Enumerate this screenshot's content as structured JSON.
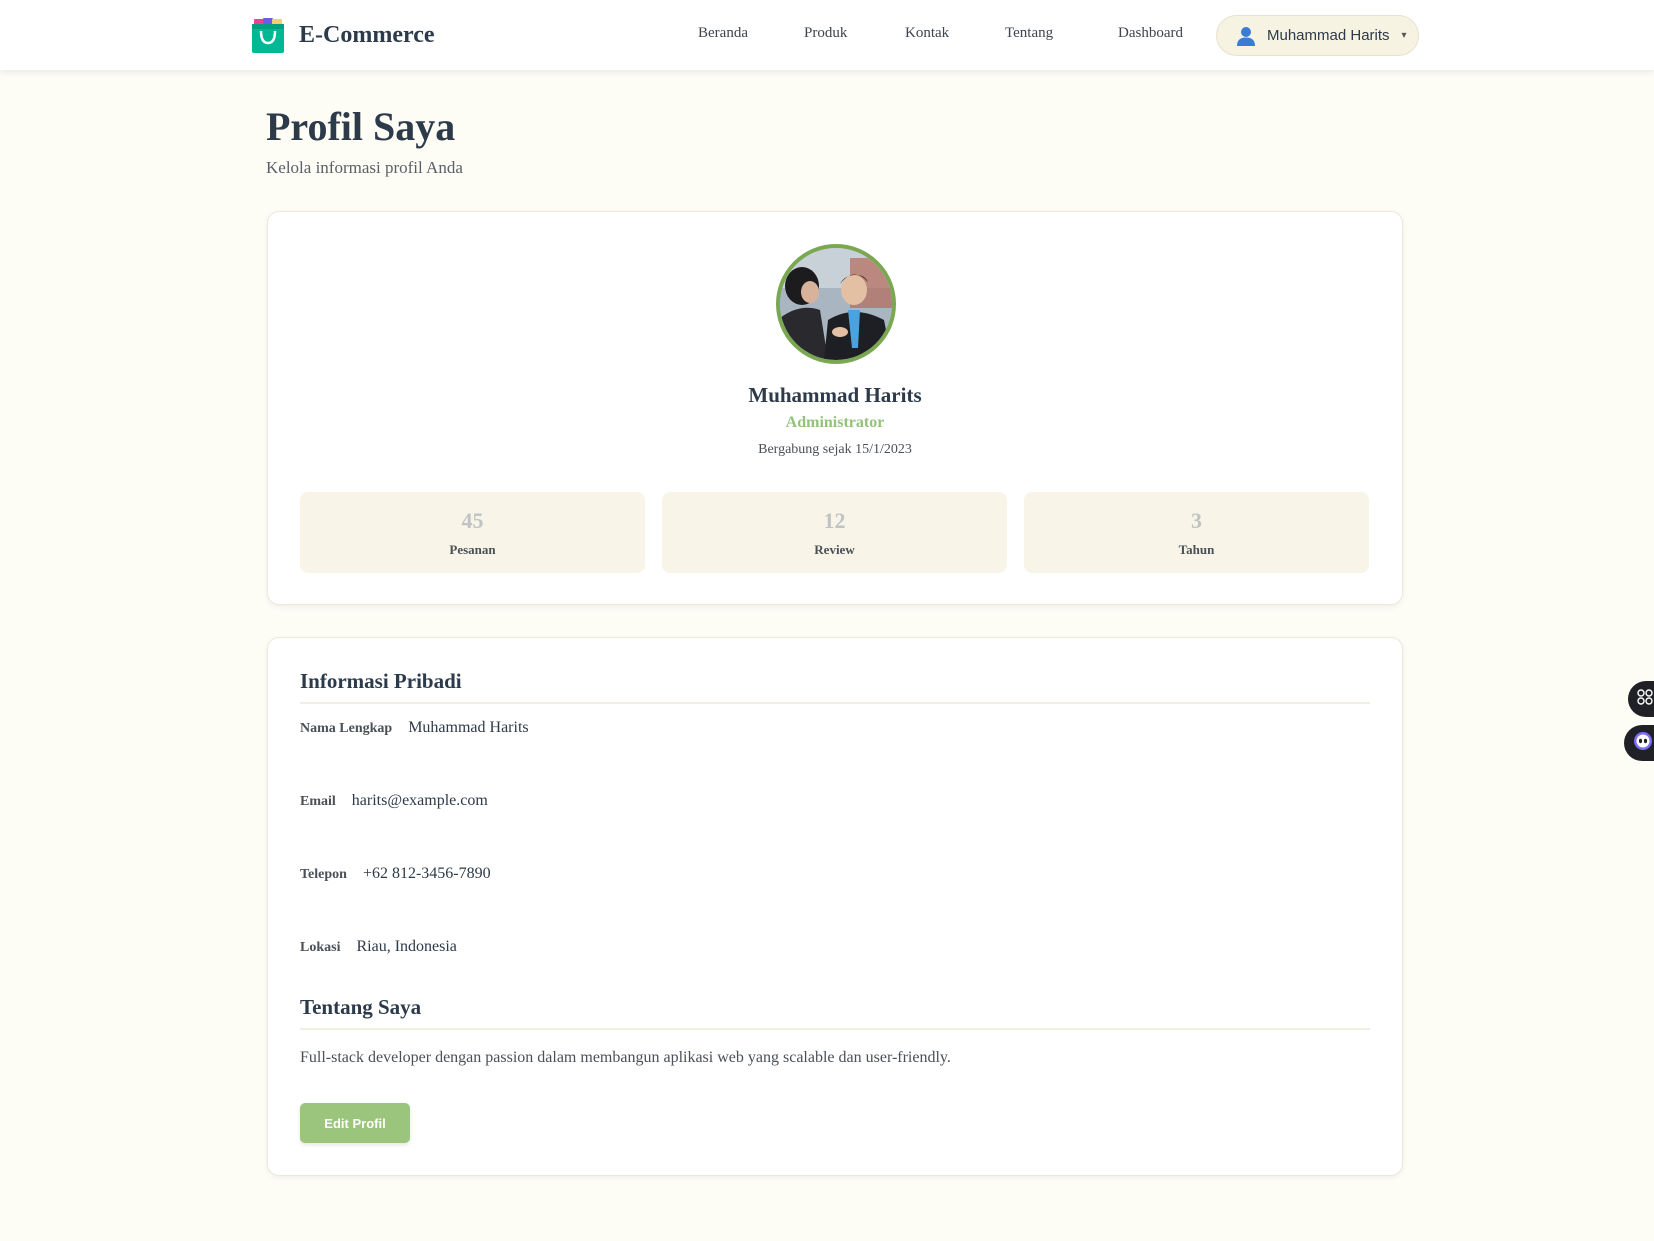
{
  "header": {
    "brand": "E-Commerce",
    "nav": [
      "Beranda",
      "Produk",
      "Kontak",
      "Tentang",
      "Dashboard"
    ],
    "user_name": "Muhammad Harits",
    "user_menu_caret": "▾"
  },
  "page": {
    "title": "Profil Saya",
    "subtitle": "Kelola informasi profil Anda"
  },
  "profile": {
    "name": "Muhammad Harits",
    "role": "Administrator",
    "joined": "Bergabung sejak 15/1/2023",
    "stats": [
      {
        "value": "45",
        "label": "Pesanan"
      },
      {
        "value": "12",
        "label": "Review"
      },
      {
        "value": "3",
        "label": "Tahun"
      }
    ]
  },
  "personal_info": {
    "title": "Informasi Pribadi",
    "fields": [
      {
        "label": "Nama Lengkap",
        "value": "Muhammad Harits"
      },
      {
        "label": "Email",
        "value": "harits@example.com"
      },
      {
        "label": "Telepon",
        "value": "+62 812-3456-7890"
      },
      {
        "label": "Lokasi",
        "value": "Riau, Indonesia"
      }
    ]
  },
  "about": {
    "title": "Tentang Saya",
    "text": "Full-stack developer dengan passion dalam membangun aplikasi web yang scalable dan user-friendly."
  },
  "actions": {
    "edit_label": "Edit Profil"
  },
  "colors": {
    "accent": "#93c27a",
    "button": "#9bc57c",
    "avatar_border": "#7aa851",
    "background": "#fdfcf5"
  },
  "icons": [
    "shopping-bag-icon",
    "user-icon",
    "chevron-down-icon",
    "apps-grid-icon",
    "assistant-bot-icon"
  ]
}
